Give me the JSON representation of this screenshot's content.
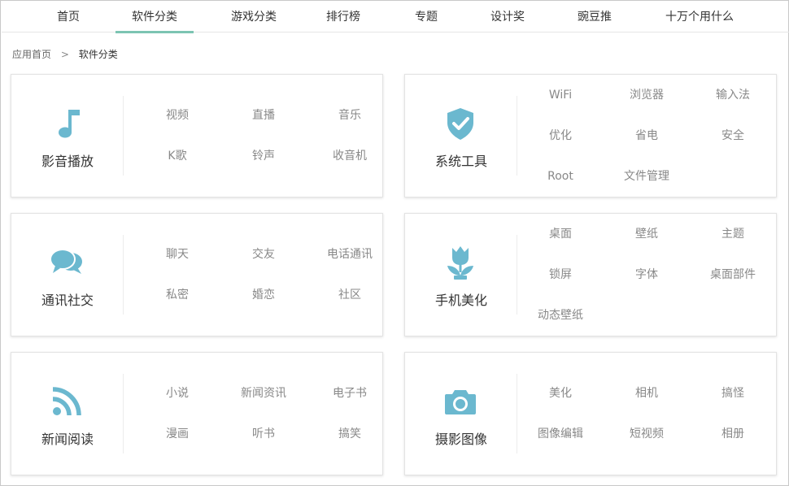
{
  "nav": {
    "items": [
      "首页",
      "软件分类",
      "游戏分类",
      "排行榜",
      "专题",
      "设计奖",
      "豌豆推",
      "十万个用什么"
    ],
    "active_index": 1
  },
  "breadcrumb": {
    "home": "应用首页",
    "separator": ">",
    "current": "软件分类"
  },
  "colors": {
    "icon": "#6bb8cf",
    "active_underline": "#7cc4b2",
    "link": "#888888"
  },
  "categories": [
    {
      "title": "影音播放",
      "icon": "music-note-icon",
      "links": [
        "视频",
        "直播",
        "音乐",
        "K歌",
        "铃声",
        "收音机"
      ]
    },
    {
      "title": "系统工具",
      "icon": "shield-check-icon",
      "links": [
        "WiFi",
        "浏览器",
        "输入法",
        "优化",
        "省电",
        "安全",
        "Root",
        "文件管理"
      ]
    },
    {
      "title": "通讯社交",
      "icon": "chat-bubbles-icon",
      "links": [
        "聊天",
        "交友",
        "电话通讯",
        "私密",
        "婚恋",
        "社区"
      ]
    },
    {
      "title": "手机美化",
      "icon": "tulip-icon",
      "links": [
        "桌面",
        "壁纸",
        "主题",
        "锁屏",
        "字体",
        "桌面部件",
        "动态壁纸"
      ]
    },
    {
      "title": "新闻阅读",
      "icon": "rss-icon",
      "links": [
        "小说",
        "新闻资讯",
        "电子书",
        "漫画",
        "听书",
        "搞笑"
      ]
    },
    {
      "title": "摄影图像",
      "icon": "camera-icon",
      "links": [
        "美化",
        "相机",
        "搞怪",
        "图像编辑",
        "短视频",
        "相册"
      ]
    }
  ]
}
